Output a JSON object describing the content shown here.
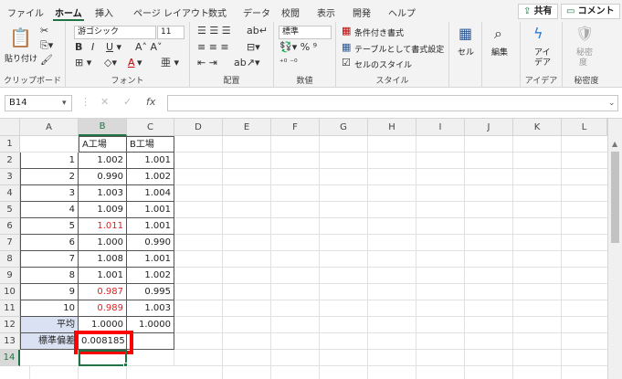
{
  "tabs": [
    "ファイル",
    "ホーム",
    "挿入",
    "ページ レイアウト",
    "数式",
    "データ",
    "校閲",
    "表示",
    "開発",
    "ヘルプ"
  ],
  "share_label": "共有",
  "comment_label": "コメント",
  "clipboard": {
    "paste": "貼り付け",
    "label": "クリップボード"
  },
  "font": {
    "name": "游ゴシック",
    "size": "11",
    "label": "フォント"
  },
  "alignment": {
    "label": "配置"
  },
  "number": {
    "format": "標準",
    "label": "数値"
  },
  "styles": {
    "cond": "条件付き書式",
    "table": "テーブルとして書式設定",
    "cell": "セルのスタイル",
    "label": "スタイル"
  },
  "cells": {
    "cell": "セル"
  },
  "edit": {
    "label": "編集"
  },
  "ideas": {
    "top": "アイ",
    "bottom": "デア",
    "label": "アイデア"
  },
  "sensitivity": {
    "top": "秘密",
    "bottom": "度",
    "label": "秘密度"
  },
  "namebox": "B14",
  "columns": [
    "A",
    "B",
    "C",
    "D",
    "E",
    "F",
    "G",
    "H",
    "I",
    "J",
    "K",
    "L"
  ],
  "rows": [
    "1",
    "2",
    "3",
    "4",
    "5",
    "6",
    "7",
    "8",
    "9",
    "10",
    "11",
    "12",
    "13",
    "14"
  ],
  "sheet": {
    "header": [
      "",
      "A工場",
      "B工場"
    ],
    "data": [
      [
        "1",
        "1.002",
        "1.001"
      ],
      [
        "2",
        "0.990",
        "1.002"
      ],
      [
        "3",
        "1.003",
        "1.004"
      ],
      [
        "4",
        "1.009",
        "1.001"
      ],
      [
        "5",
        "1.011",
        "1.001"
      ],
      [
        "6",
        "1.000",
        "0.990"
      ],
      [
        "7",
        "1.008",
        "1.001"
      ],
      [
        "8",
        "1.001",
        "1.002"
      ],
      [
        "9",
        "0.987",
        "0.995"
      ],
      [
        "10",
        "0.989",
        "1.003"
      ]
    ],
    "avg": [
      "平均",
      "1.0000",
      "1.0000"
    ],
    "std": [
      "標準偏差",
      "0.008185",
      ""
    ]
  },
  "colors": {
    "accent": "#217346",
    "highlight": "#ff0000",
    "header_fill": "#d9e1f2",
    "red_text": "#e02020"
  }
}
